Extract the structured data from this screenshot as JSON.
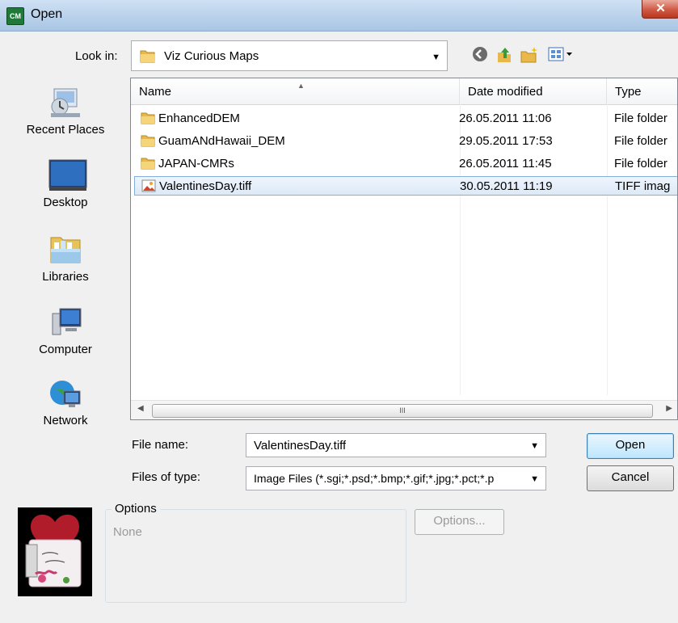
{
  "window": {
    "title": "Open",
    "app_icon_text": "CM",
    "close_label": "✕"
  },
  "look_in": {
    "label": "Look in:",
    "value": "Viz Curious Maps"
  },
  "places": [
    {
      "label": "Recent Places"
    },
    {
      "label": "Desktop"
    },
    {
      "label": "Libraries"
    },
    {
      "label": "Computer"
    },
    {
      "label": "Network"
    }
  ],
  "file_list": {
    "columns": [
      "Name",
      "Date modified",
      "Type"
    ],
    "rows": [
      {
        "name": "EnhancedDEM",
        "date": "26.05.2011 11:06",
        "type": "File folder",
        "icon": "folder-icon"
      },
      {
        "name": "GuamANdHawaii_DEM",
        "date": "29.05.2011 17:53",
        "type": "File folder",
        "icon": "folder-icon"
      },
      {
        "name": "JAPAN-CMRs",
        "date": "26.05.2011 11:45",
        "type": "File folder",
        "icon": "folder-icon"
      },
      {
        "name": "ValentinesDay.tiff",
        "date": "30.05.2011 11:19",
        "type": "TIFF imag",
        "icon": "tiff-image-icon",
        "selected": true
      }
    ],
    "scroll_grip": "III"
  },
  "file_name": {
    "label": "File name:",
    "value": "ValentinesDay.tiff"
  },
  "file_type": {
    "label": "Files of type:",
    "value": "Image Files (*.sgi;*.psd;*.bmp;*.gif;*.jpg;*.pct;*.p"
  },
  "buttons": {
    "open": "Open",
    "cancel": "Cancel",
    "options": "Options..."
  },
  "options_group": {
    "legend": "Options",
    "value": "None"
  },
  "colors": {
    "selection": "#dde9f7",
    "title_bar": "#b9d1ea",
    "close_button": "#cf5a43"
  }
}
